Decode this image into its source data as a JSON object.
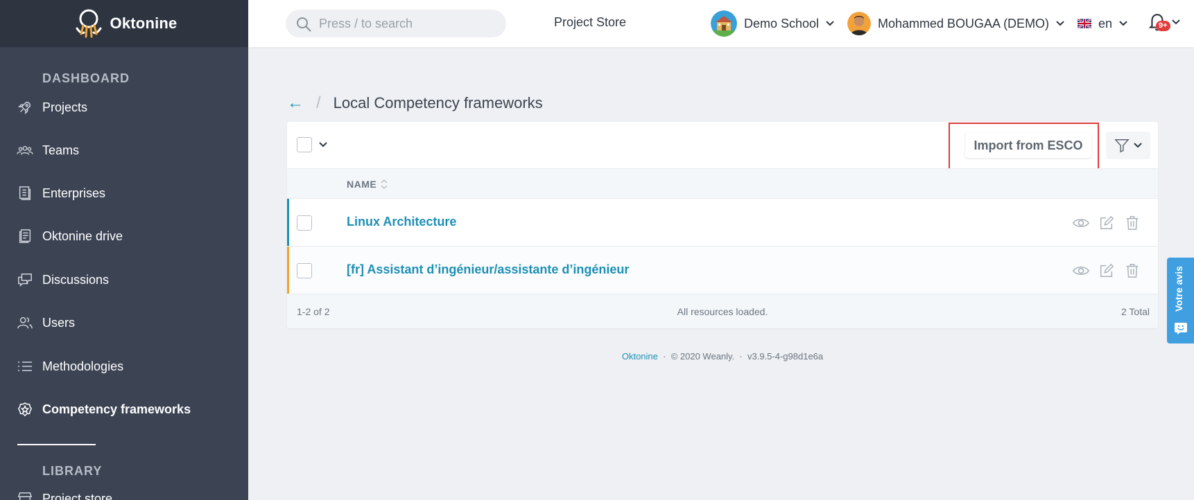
{
  "brand": {
    "name": "Oktonine"
  },
  "sidebar": {
    "section_dashboard": "DASHBOARD",
    "items": [
      {
        "label": "Projects",
        "icon": "rocket-icon"
      },
      {
        "label": "Teams",
        "icon": "team-icon"
      },
      {
        "label": "Enterprises",
        "icon": "building-icon"
      },
      {
        "label": "Oktonine drive",
        "icon": "drive-icon"
      },
      {
        "label": "Discussions",
        "icon": "chat-icon"
      },
      {
        "label": "Users",
        "icon": "users-icon"
      },
      {
        "label": "Methodologies",
        "icon": "list-icon"
      },
      {
        "label": "Competency frameworks",
        "icon": "badge-icon",
        "active": true
      }
    ],
    "section_library": "LIBRARY",
    "library_items": [
      {
        "label": "Project store",
        "icon": "store-icon"
      }
    ]
  },
  "topbar": {
    "search_placeholder": "Press / to search",
    "project_store": "Project Store",
    "workspace": "Demo School",
    "user": "Mohammed BOUGAA (DEMO)",
    "language": "en",
    "notifications_badge": "9+"
  },
  "page": {
    "back": "←",
    "separator": "/",
    "title": "Local Competency frameworks"
  },
  "toolbar": {
    "import_label": "Import from ESCO"
  },
  "table": {
    "header_name": "NAME",
    "rows": [
      {
        "name": "Linux Architecture",
        "stripe": "#1d8fb5"
      },
      {
        "name": "[fr] Assistant d’ingénieur/assistante d’ingénieur",
        "stripe": "#f0a432"
      }
    ],
    "footer_range": "1-2 of 2",
    "footer_status": "All resources loaded.",
    "footer_total": "2 Total"
  },
  "footer": {
    "brand_link": "Oktonine",
    "sep1": "·",
    "copyright": "© 2020 Weanly.",
    "sep2": "·",
    "version": "v3.9.5-4-g98d1e6a"
  },
  "feedback": {
    "label": "Votre avis"
  },
  "colors": {
    "sidebar": "#3c4454",
    "brand_bar": "#2e3440",
    "accent": "#1d8fb5",
    "highlight": "#e03a3a",
    "feedback": "#3f9fe0"
  }
}
